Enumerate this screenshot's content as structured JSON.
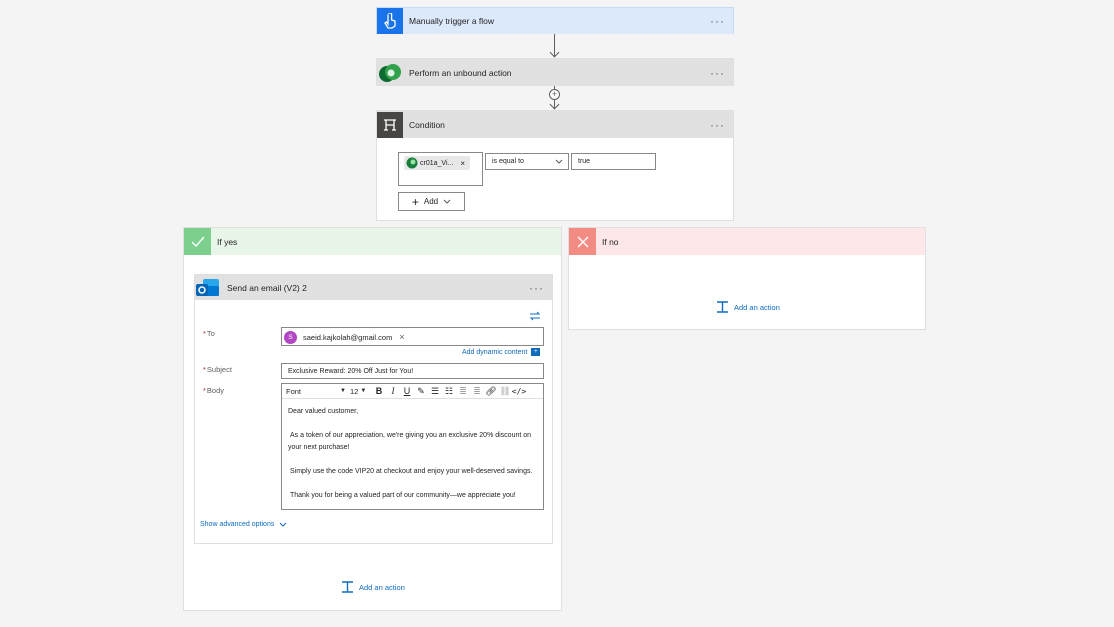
{
  "colors": {
    "trigger_bg": "#dce9fb",
    "trigger_icon_bg": "#1a73e8",
    "action_bg": "#e1e1e1",
    "condition_icon_bg": "#484644",
    "yes_bg": "#e8f5e9",
    "yes_icon_bg": "#7ccf8c",
    "no_bg": "#fde7e9",
    "no_icon_bg": "#f28b82",
    "link": "#0f6cbd"
  },
  "trigger": {
    "title": "Manually trigger a flow",
    "icon": "touch-hand-icon"
  },
  "unbound_action": {
    "title": "Perform an unbound action",
    "icon": "dataverse-icon"
  },
  "condition": {
    "title": "Condition",
    "icon": "condition-icon",
    "token_label": "cr01a_Vi...",
    "operator": "is equal to",
    "value": "true",
    "add_label": "Add"
  },
  "if_yes": {
    "title": "If yes",
    "add_action": "Add an action",
    "email": {
      "title": "Send an email (V2) 2",
      "to_label": "To",
      "to_avatar": "S",
      "to_value": "saeid.kajkolah@gmail.com",
      "dynamic_content": "Add dynamic content",
      "subject_label": "Subject",
      "subject_value": "Exclusive Reward: 20% Off Just for You!",
      "body_label": "Body",
      "font_label": "Font",
      "font_size": "12",
      "body_lines": [
        "Dear valued customer,",
        "As a token of our appreciation, we're giving you an exclusive 20% discount on",
        "your next purchase!",
        "Simply use the code VIP20 at checkout and enjoy your well-deserved savings.",
        "Thank you for being a valued part of our community—we appreciate you!"
      ],
      "advanced_options": "Show advanced options"
    }
  },
  "if_no": {
    "title": "If no",
    "add_action": "Add an action"
  }
}
